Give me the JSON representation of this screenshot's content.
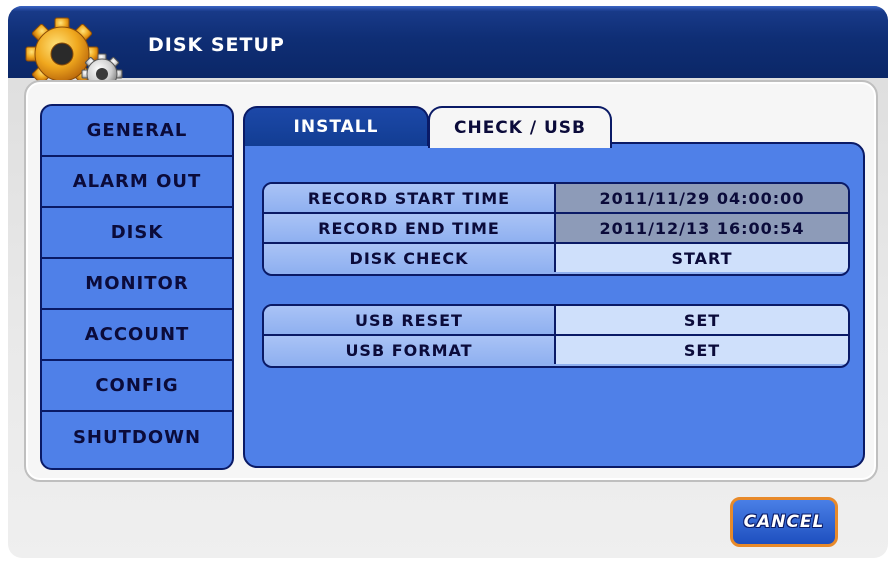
{
  "window": {
    "title": "DISK SETUP",
    "icon": "gear-icon"
  },
  "sidebar": {
    "items": [
      {
        "label": "GENERAL"
      },
      {
        "label": "ALARM OUT"
      },
      {
        "label": "DISK"
      },
      {
        "label": "MONITOR"
      },
      {
        "label": "ACCOUNT"
      },
      {
        "label": "CONFIG"
      },
      {
        "label": "SHUTDOWN"
      }
    ],
    "selected": "DISK"
  },
  "tabs": [
    {
      "label": "INSTALL",
      "active": false
    },
    {
      "label": "CHECK / USB",
      "active": true
    }
  ],
  "disk_section": {
    "rows": [
      {
        "label": "RECORD START TIME",
        "value": "2011/11/29 04:00:00"
      },
      {
        "label": "RECORD END TIME",
        "value": "2011/12/13 16:00:54"
      },
      {
        "label": "DISK CHECK",
        "value": "START"
      }
    ]
  },
  "usb_section": {
    "rows": [
      {
        "label": "USB RESET",
        "value": "SET"
      },
      {
        "label": "USB FORMAT",
        "value": "SET"
      }
    ]
  },
  "footer": {
    "cancel_label": "CANCEL"
  },
  "colors": {
    "title_bar": "#0f2e75",
    "panel_blue": "#4f80e8",
    "border_navy": "#0a1a66",
    "readonly_value": "#8d9bb8",
    "button_value": "#cfe0fb",
    "cancel_border": "#e88a2a"
  }
}
